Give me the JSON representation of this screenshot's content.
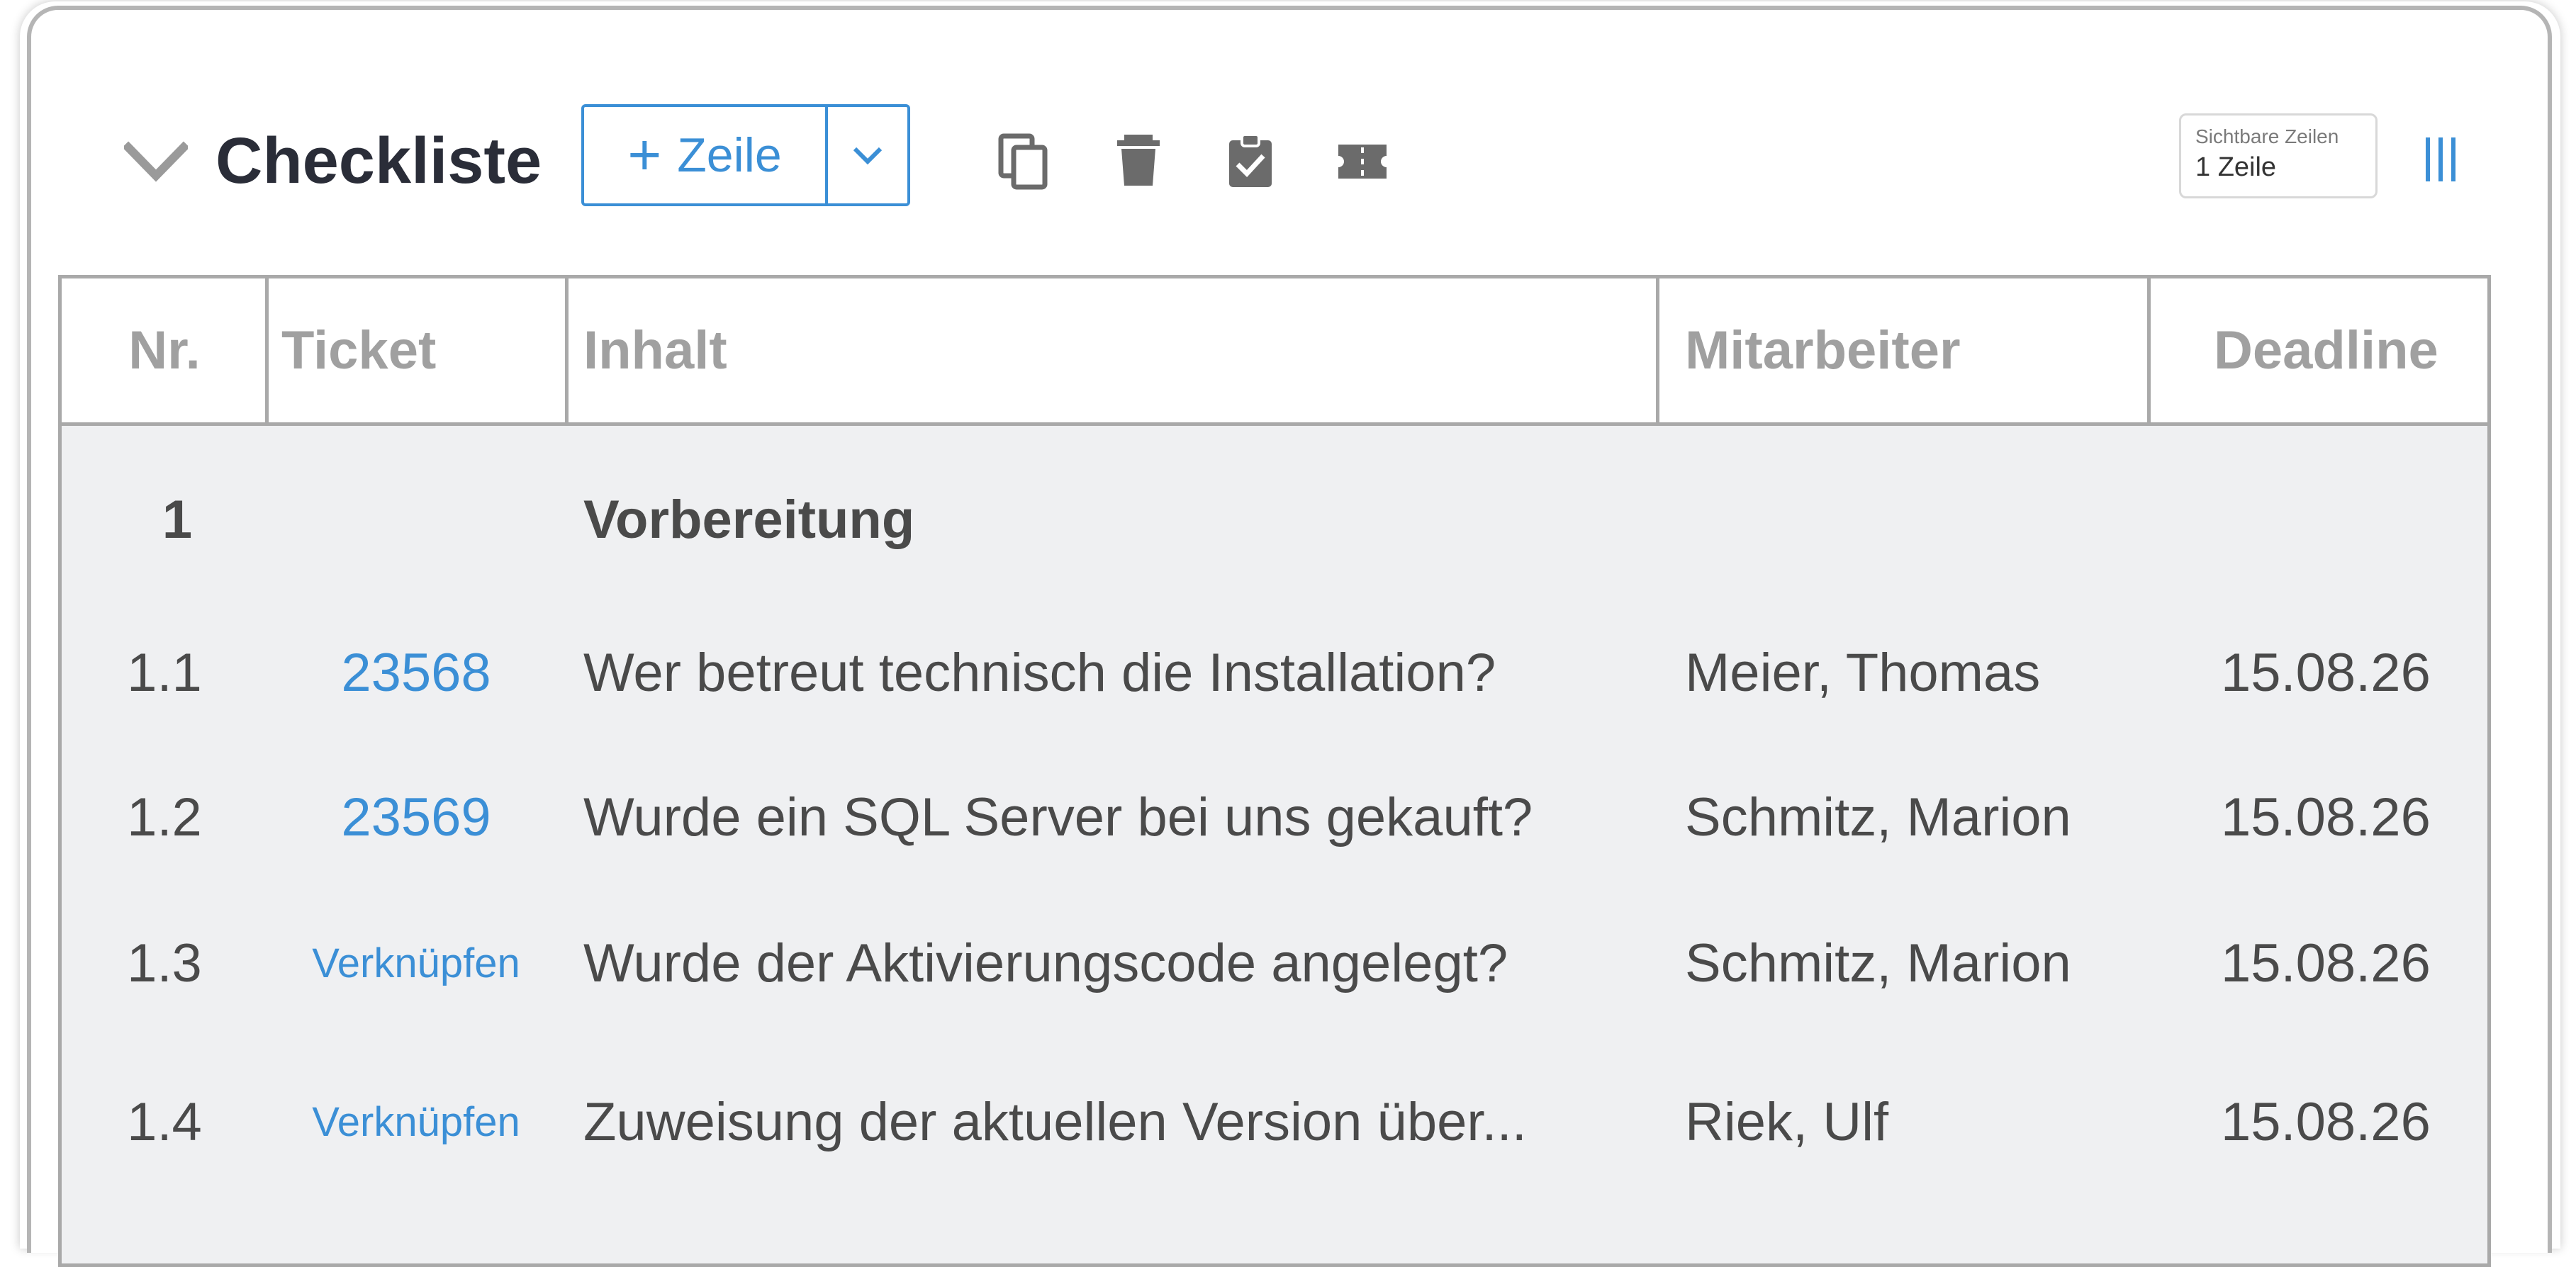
{
  "header": {
    "title": "Checkliste",
    "add_row_label": "Zeile",
    "visible_rows": {
      "label": "Sichtbare Zeilen",
      "value": "1 Zeile"
    }
  },
  "toolbar_icons": [
    "copy-icon",
    "delete-icon",
    "clipboard-check-icon",
    "ticket-icon"
  ],
  "table": {
    "columns": [
      "Nr.",
      "Ticket",
      "Inhalt",
      "Mitarbeiter",
      "Deadline"
    ],
    "rows": [
      {
        "nr": "1",
        "ticket": "",
        "content": "Vorbereitung",
        "employee": "",
        "deadline": "",
        "group": true
      },
      {
        "nr": "1.1",
        "ticket": "23568",
        "content": "Wer betreut technisch die Installation?",
        "employee": "Meier, Thomas",
        "deadline": "15.08.26"
      },
      {
        "nr": "1.2",
        "ticket": "23569",
        "content": "Wurde ein SQL Server bei uns gekauft?",
        "employee": "Schmitz, Marion",
        "deadline": "15.08.26"
      },
      {
        "nr": "1.3",
        "ticket": "Verknüpfen",
        "content": "Wurde der Aktivierungscode angelegt?",
        "employee": "Schmitz, Marion",
        "deadline": "15.08.26"
      },
      {
        "nr": "1.4",
        "ticket": "Verknüpfen",
        "content": "Zuweisung der aktuellen Version über...",
        "employee": "Riek, Ulf",
        "deadline": "15.08.26"
      }
    ]
  },
  "colors": {
    "accent": "#3b8fd6",
    "title": "#2a2d38",
    "header_text": "#a0a0a0",
    "body_text": "#4a4a4a",
    "row_background": "#eff0f2",
    "border": "#a9a9a9",
    "icon": "#6b6b6b"
  }
}
